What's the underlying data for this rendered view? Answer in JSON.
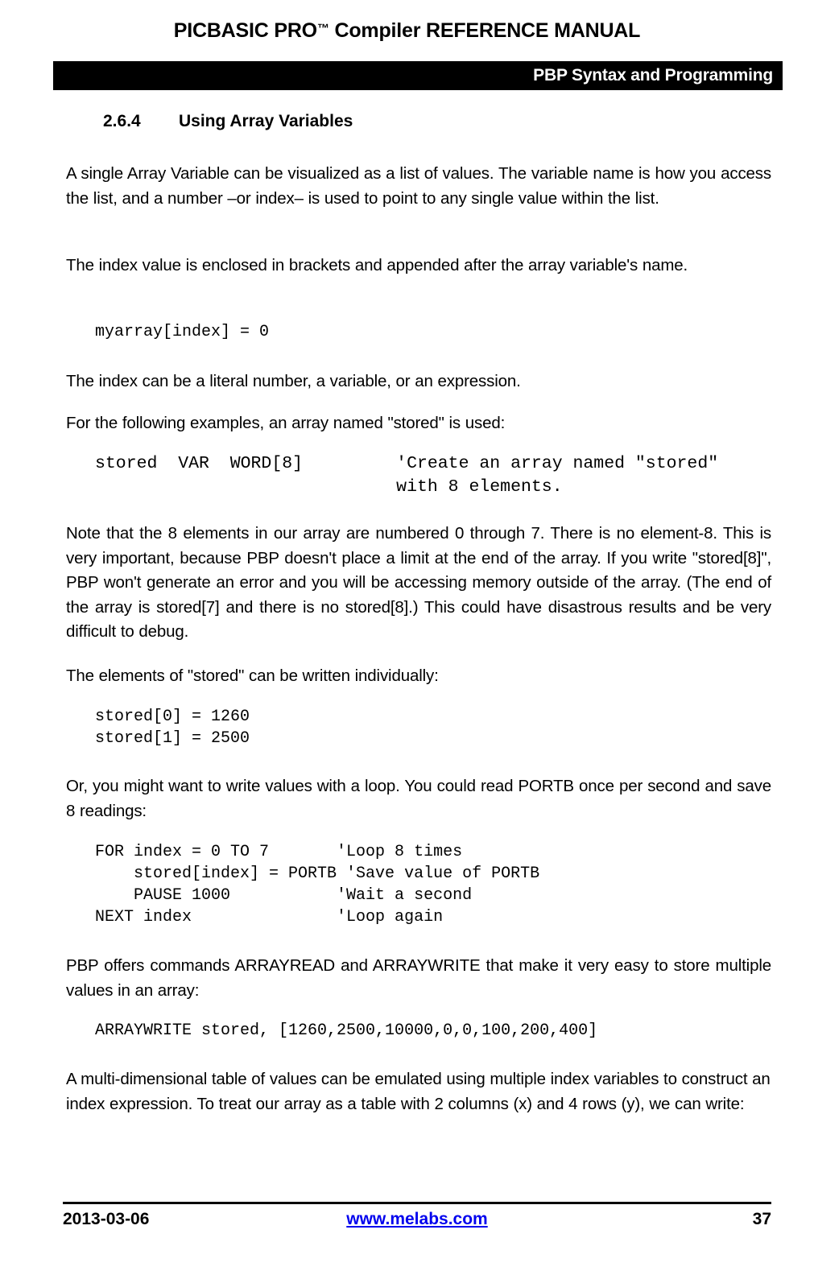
{
  "header": {
    "title_main": "PICBASIC PRO",
    "title_tm": "™",
    "title_rest": " Compiler REFERENCE MANUAL",
    "bar_label": "PBP Syntax and Programming",
    "bar_color": "#000000",
    "bar_text_color": "#ffffff"
  },
  "section": {
    "number": "2.6.4",
    "title": "Using Array Variables"
  },
  "body": {
    "p1": "A single Array Variable can be visualized as a list of values.  The variable name is how you access the list, and a number –or index– is used to point to any single value within the list.",
    "p2": "The index value is enclosed in brackets and appended after the array variable's name.",
    "code1": "myarray[index] = 0",
    "p3": "The index can be a literal number, a variable, or an expression.",
    "p4": "For the following examples, an array named \"stored\" is used:",
    "code2": "stored  VAR  WORD[8]         'Create an array named \"stored\"\n                             with 8 elements.",
    "p5": "Note that the 8 elements in our array are numbered 0 through 7.  There is no element-8.  This is very important, because PBP doesn't place a limit at the end of the array.  If you write \"stored[8]\", PBP won't generate an error and you will be accessing memory outside of the array.  (The end of the array is stored[7] and there is no stored[8].)  This could have disastrous results and be very difficult to debug.",
    "p6": "The elements of \"stored\" can be written individually:",
    "code3": "stored[0] = 1260\nstored[1] = 2500",
    "p7": "Or, you might want to write values with a loop.  You could read PORTB once per second and save 8 readings:",
    "code4": "FOR index = 0 TO 7       'Loop 8 times\n    stored[index] = PORTB 'Save value of PORTB\n    PAUSE 1000           'Wait a second\nNEXT index               'Loop again",
    "p8": "PBP offers commands ARRAYREAD and ARRAYWRITE that make it very easy to store multiple values in an array:",
    "code5": "ARRAYWRITE stored, [1260,2500,10000,0,0,100,200,400]",
    "p9": "A multi-dimensional table of values can be emulated using multiple index variables to construct an index expression.  To treat our array as a table with 2 columns (x) and 4 rows (y), we can write:"
  },
  "footer": {
    "date": "2013-03-06",
    "link_text": "www.melabs.com",
    "link_color": "#0000ee",
    "page_number": "37"
  }
}
